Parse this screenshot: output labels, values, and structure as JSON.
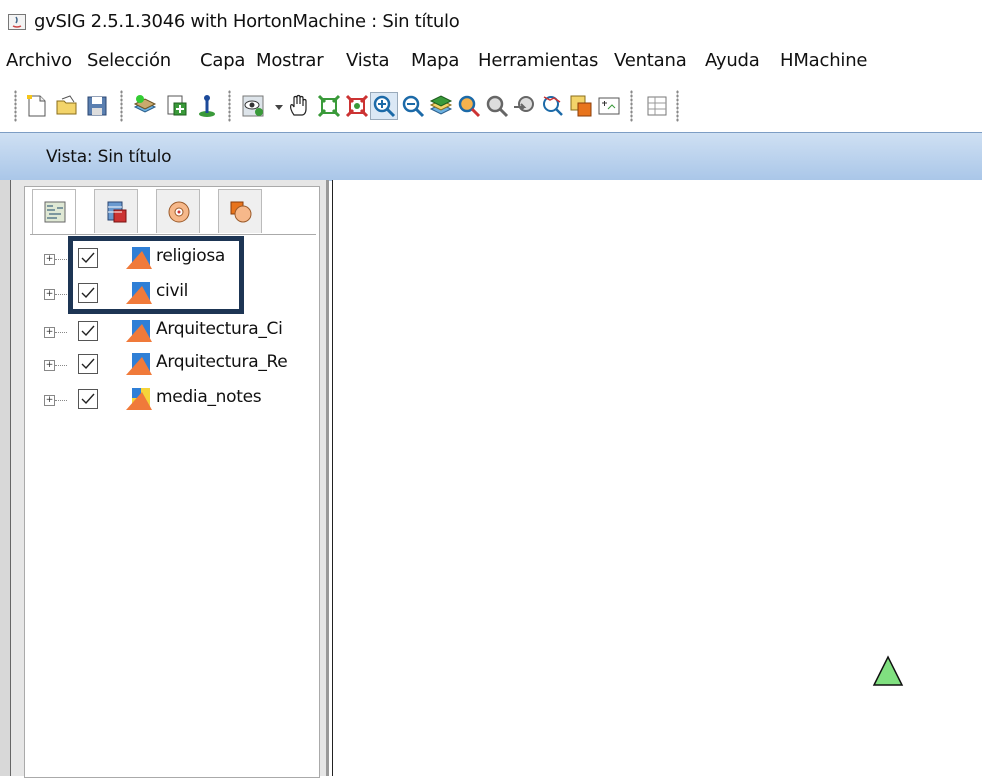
{
  "window": {
    "title": "gvSIG 2.5.1.3046 with HortonMachine : Sin título"
  },
  "menu": {
    "items": [
      "Archivo",
      "Selección",
      "Capa",
      "Mostrar",
      "Vista",
      "Mapa",
      "Herramientas",
      "Ventana",
      "Ayuda",
      "HMachine"
    ]
  },
  "toolbar": {
    "icons": [
      "new-project-icon",
      "open-project-icon",
      "save-project-icon",
      "add-layer-icon",
      "new-layer-icon",
      "add-point-icon",
      "view-info-icon",
      "dropdown-arrow-icon",
      "pan-icon",
      "zoom-full-icon",
      "zoom-select-icon",
      "zoom-in-icon",
      "zoom-out-icon",
      "zoom-layer-icon",
      "zoom-map-icon",
      "zoom-previous-icon",
      "zoom-back-icon",
      "measure-icon",
      "locator-icon",
      "frame-icon",
      "table-icon"
    ]
  },
  "view": {
    "title": "Vista: Sin título"
  },
  "toc": {
    "tabs": [
      "layers-tab-icon",
      "database-tab-icon",
      "geoprocess-tab-icon",
      "shapes-tab-icon"
    ],
    "layers": [
      {
        "label": "religiosa",
        "checked": true
      },
      {
        "label": "civil",
        "checked": true
      },
      {
        "label": "Arquitectura_Ci",
        "checked": true
      },
      {
        "label": "Arquitectura_Re",
        "checked": true
      },
      {
        "label": "media_notes",
        "checked": true
      }
    ]
  },
  "colors": {
    "header_gradient_top": "#cfe0f3",
    "header_gradient_bottom": "#a9c6e8",
    "highlight_border": "#1d3554",
    "map_feature_fill": "#80e080"
  }
}
